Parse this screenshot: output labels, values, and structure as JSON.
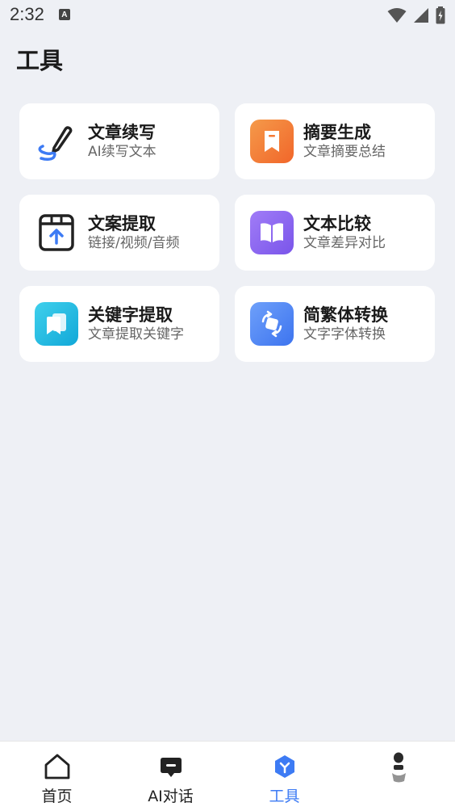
{
  "status_bar": {
    "time": "2:32",
    "notification_icon_letter": "A"
  },
  "page": {
    "title": "工具"
  },
  "tools": [
    {
      "title": "文章续写",
      "subtitle": "AI续写文本",
      "icon": "pen-icon",
      "color": "#3d7bf4"
    },
    {
      "title": "摘要生成",
      "subtitle": "文章摘要总结",
      "icon": "bookmark-icon",
      "color": "#f47a35"
    },
    {
      "title": "文案提取",
      "subtitle": "链接/视频/音频",
      "icon": "box-upload-icon",
      "color": "#222222"
    },
    {
      "title": "文本比较",
      "subtitle": "文章差异对比",
      "icon": "book-icon",
      "color": "#8f66f0"
    },
    {
      "title": "关键字提取",
      "subtitle": "文章提取关键字",
      "icon": "pages-icon",
      "color": "#1fb7e3"
    },
    {
      "title": "简繁体转换",
      "subtitle": "文字字体转换",
      "icon": "convert-icon",
      "color": "#4f8af7"
    }
  ],
  "tabbar": {
    "items": [
      {
        "label": "首页",
        "icon": "home-icon"
      },
      {
        "label": "AI对话",
        "icon": "chat-icon"
      },
      {
        "label": "工具",
        "icon": "tools-icon",
        "active": true
      },
      {
        "label": "",
        "icon": "avatar-icon"
      }
    ]
  },
  "colors": {
    "accent": "#3d7bf4",
    "background": "#eef0f5"
  }
}
